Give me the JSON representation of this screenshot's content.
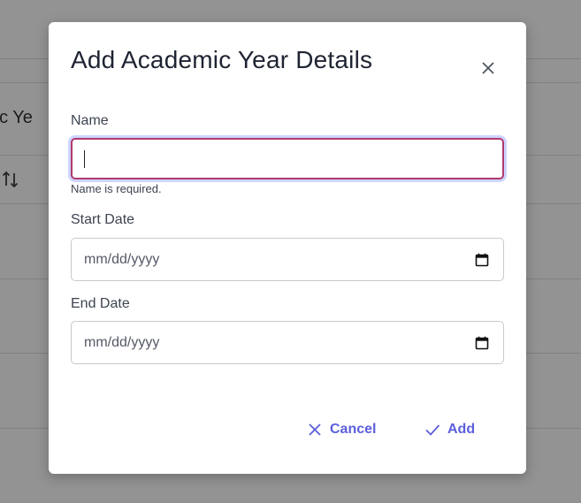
{
  "background": {
    "partial_heading": "mic Ye"
  },
  "dialog": {
    "title": "Add Academic Year Details",
    "fields": {
      "name": {
        "label": "Name",
        "value": "",
        "error": "Name is required."
      },
      "start_date": {
        "label": "Start Date",
        "placeholder": "mm/dd/yyyy"
      },
      "end_date": {
        "label": "End Date",
        "placeholder": "mm/dd/yyyy"
      }
    },
    "actions": {
      "cancel_label": "Cancel",
      "add_label": "Add"
    }
  },
  "colors": {
    "accent": "#5b5fdb",
    "error_border": "#b03a6e",
    "focus_ring": "#cdd4ff",
    "overlay": "rgba(40,40,40,0.5)"
  },
  "icons": {
    "close": "close-icon",
    "calendar": "calendar-icon",
    "cancel": "x-icon",
    "add": "check-icon",
    "sort": "sort-icon"
  }
}
